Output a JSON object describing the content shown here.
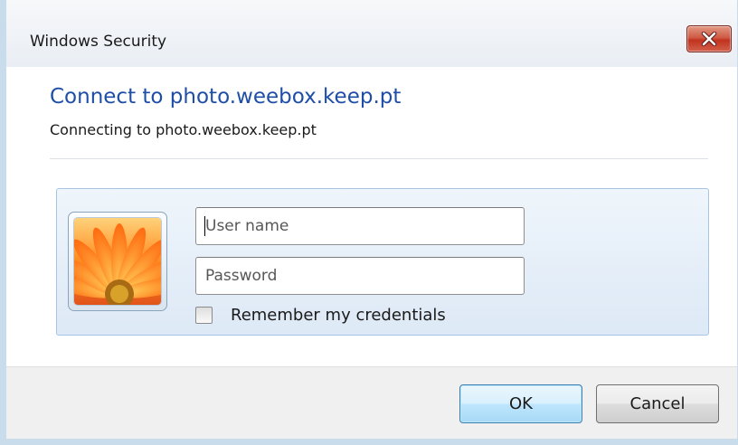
{
  "window": {
    "title": "Windows Security",
    "close_icon": "close-x-icon"
  },
  "header": {
    "heading": "Connect to photo.weebox.keep.pt",
    "subheading": "Connecting to photo.weebox.keep.pt"
  },
  "credentials": {
    "user_tile_icon": "flower-user-tile-icon",
    "username_placeholder": "User name",
    "username_value": "",
    "password_placeholder": "Password",
    "password_value": "",
    "remember_label": "Remember my credentials",
    "remember_checked": false
  },
  "buttons": {
    "ok_label": "OK",
    "cancel_label": "Cancel"
  },
  "colors": {
    "heading": "#1e4ea6",
    "close_button": "#c2331f",
    "default_button_border": "#3c7fb1"
  }
}
